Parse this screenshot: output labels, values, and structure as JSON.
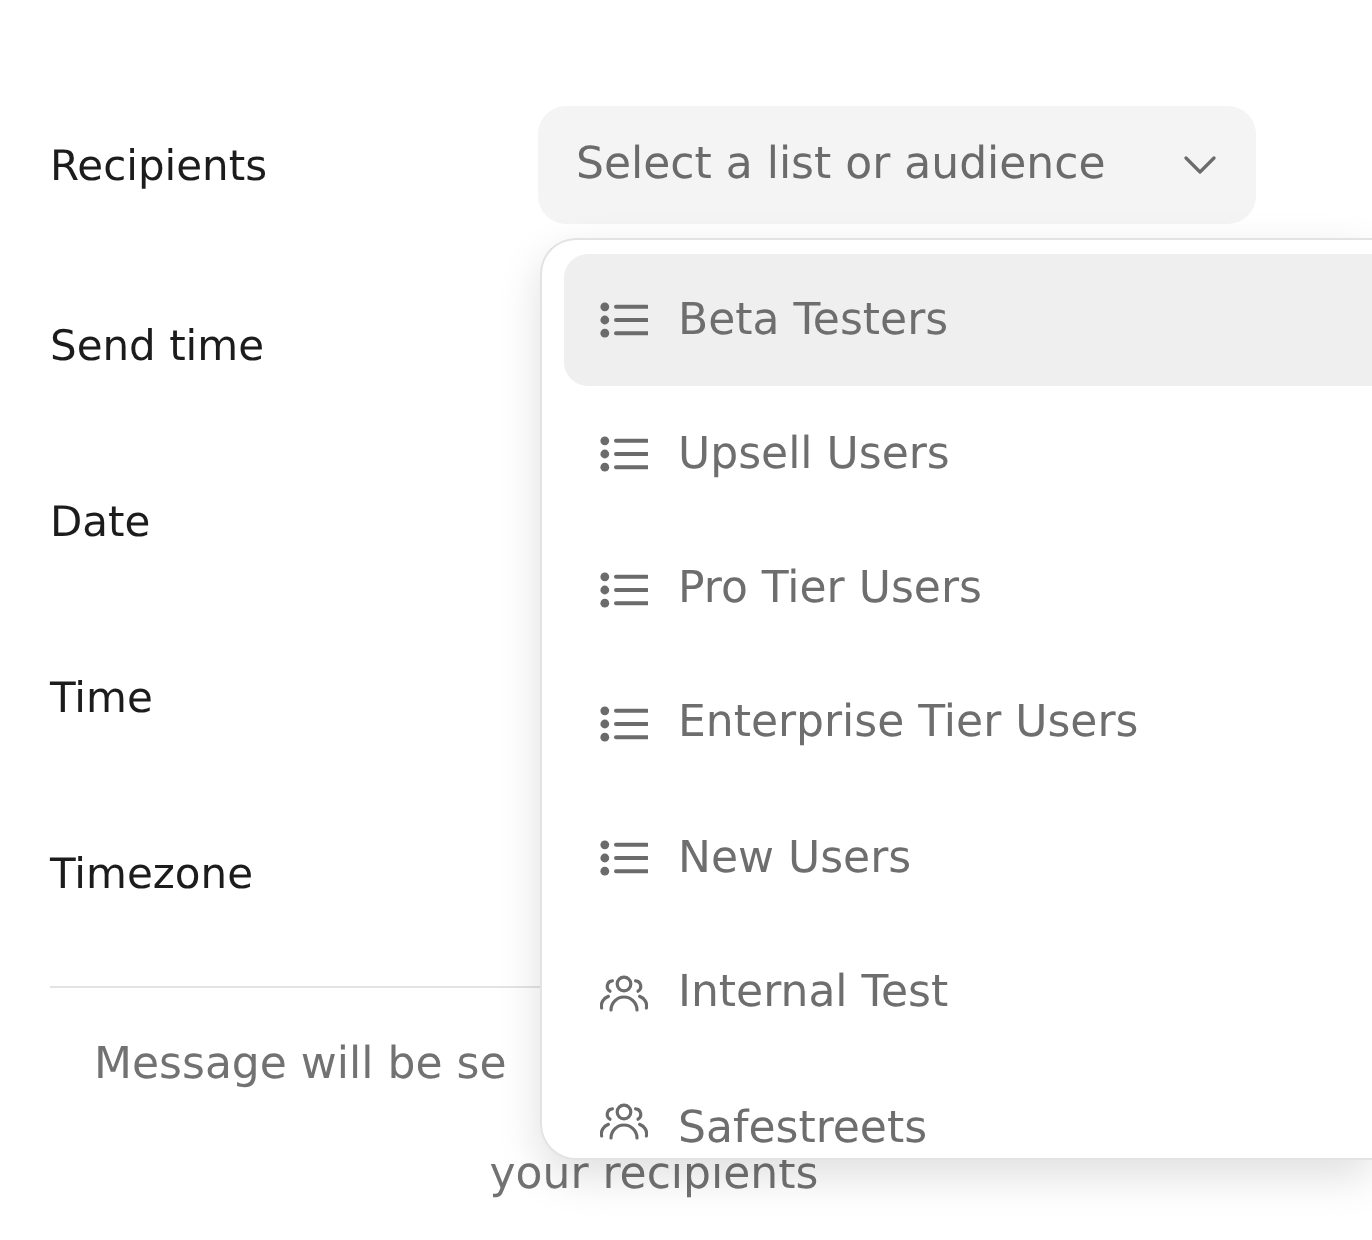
{
  "form": {
    "recipients": {
      "label": "Recipients",
      "select": {
        "placeholder": "Select a list or audience",
        "expanded": true
      }
    },
    "labels": [
      "Send time",
      "Date",
      "Time",
      "Timezone"
    ]
  },
  "message": {
    "lines": [
      "Message will be se",
      "your recipients"
    ]
  },
  "dropdown": {
    "items": [
      {
        "label": "Beta Testers",
        "kind": "list",
        "selected": true
      },
      {
        "label": "Upsell Users",
        "kind": "list",
        "selected": false
      },
      {
        "label": "Pro Tier Users",
        "kind": "list",
        "selected": false
      },
      {
        "label": "Enterprise Tier Users",
        "kind": "list",
        "selected": false
      },
      {
        "label": "New Users",
        "kind": "list",
        "selected": false
      },
      {
        "label": "Internal Test",
        "kind": "audience",
        "selected": false
      },
      {
        "label": "Safestreets",
        "kind": "audience",
        "selected": false
      }
    ]
  }
}
